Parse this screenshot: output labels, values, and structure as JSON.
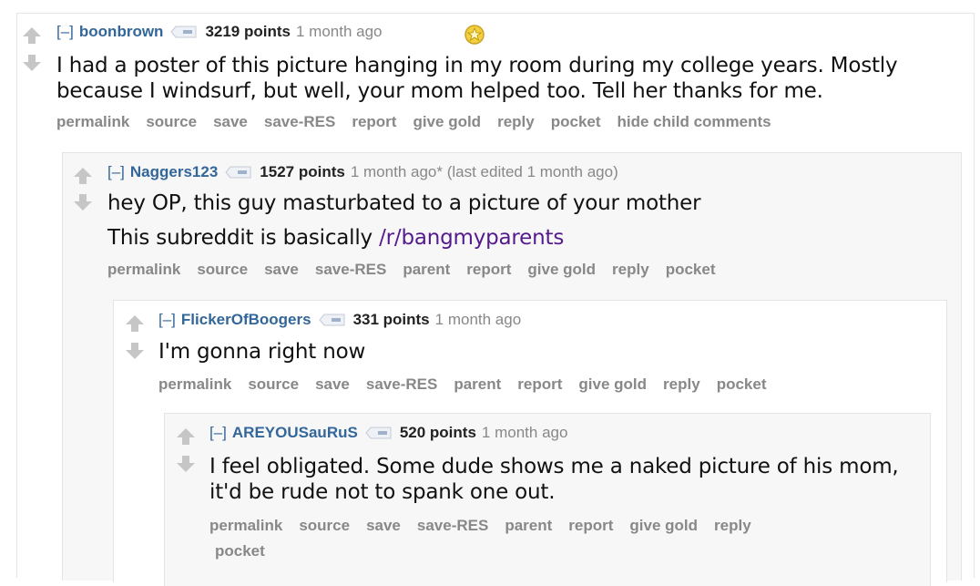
{
  "colors": {
    "link": "#336699",
    "meta": "#888888",
    "body": "#111111",
    "visited": "#551a8b",
    "arrow": "#c6c6c6"
  },
  "comments": [
    {
      "collapse": "[–]",
      "author": "boonbrown",
      "points": "3219 points",
      "time": "1 month ago",
      "gilded_icon": "gold-star-icon",
      "lines": [
        "I had a poster of this picture hanging in my room during my college years. Mostly because I windsurf, but well, your mom helped too. Tell her thanks for me."
      ],
      "buttons": [
        "permalink",
        "source",
        "save",
        "save-RES",
        "report",
        "give gold",
        "reply",
        "pocket",
        "hide child comments"
      ]
    },
    {
      "collapse": "[–]",
      "author": "Naggers123",
      "points": "1527 points",
      "time": "1 month ago* (last edited 1 month ago)",
      "line1": "hey OP, this guy masturbated to a picture of your mother",
      "line2_prefix": "This subreddit is basically ",
      "line2_link": "/r/bangmyparents",
      "buttons": [
        "permalink",
        "source",
        "save",
        "save-RES",
        "parent",
        "report",
        "give gold",
        "reply",
        "pocket"
      ]
    },
    {
      "collapse": "[–]",
      "author": "FlickerOfBoogers",
      "points": "331 points",
      "time": "1 month ago",
      "line1": "I'm gonna right now",
      "buttons": [
        "permalink",
        "source",
        "save",
        "save-RES",
        "parent",
        "report",
        "give gold",
        "reply",
        "pocket"
      ]
    },
    {
      "collapse": "[–]",
      "author": "AREYOUSauRuS",
      "points": "520 points",
      "time": "1 month ago",
      "line1": "I feel obligated. Some dude shows me a naked picture of his mom, it'd be rude not to spank one out.",
      "buttons": [
        "permalink",
        "source",
        "save",
        "save-RES",
        "parent",
        "report",
        "give gold",
        "reply",
        "pocket"
      ]
    }
  ]
}
